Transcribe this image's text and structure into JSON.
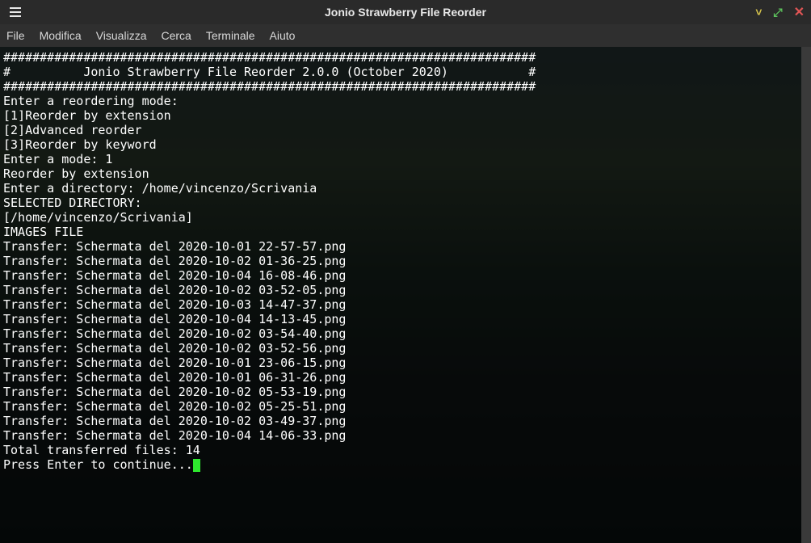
{
  "window": {
    "title": "Jonio Strawberry File Reorder"
  },
  "menu": {
    "items": [
      "File",
      "Modifica",
      "Visualizza",
      "Cerca",
      "Terminale",
      "Aiuto"
    ]
  },
  "terminal": {
    "sep": "#########################################################################",
    "banner": "#          Jonio Strawberry File Reorder 2.0.0 (October 2020)           #",
    "prompt_mode": "Enter a reordering mode:",
    "opt1": "[1]Reorder by extension",
    "opt2": "[2]Advanced reorder",
    "opt3": "[3]Reorder by keyword",
    "enter_mode": "Enter a mode: 1",
    "mode_name": "Reorder by extension",
    "enter_dir": "Enter a directory: /home/vincenzo/Scrivania",
    "selected": "SELECTED DIRECTORY:",
    "dir": "[/home/vincenzo/Scrivania]",
    "images_header": "IMAGES FILE",
    "transfers": [
      "Transfer: Schermata del 2020-10-01 22-57-57.png",
      "Transfer: Schermata del 2020-10-02 01-36-25.png",
      "Transfer: Schermata del 2020-10-04 16-08-46.png",
      "Transfer: Schermata del 2020-10-02 03-52-05.png",
      "Transfer: Schermata del 2020-10-03 14-47-37.png",
      "Transfer: Schermata del 2020-10-04 14-13-45.png",
      "Transfer: Schermata del 2020-10-02 03-54-40.png",
      "Transfer: Schermata del 2020-10-02 03-52-56.png",
      "Transfer: Schermata del 2020-10-01 23-06-15.png",
      "Transfer: Schermata del 2020-10-01 06-31-26.png",
      "Transfer: Schermata del 2020-10-02 05-53-19.png",
      "Transfer: Schermata del 2020-10-02 05-25-51.png",
      "Transfer: Schermata del 2020-10-02 03-49-37.png",
      "Transfer: Schermata del 2020-10-04 14-06-33.png"
    ],
    "total": "Total transferred files: 14",
    "continue": "Press Enter to continue..."
  }
}
